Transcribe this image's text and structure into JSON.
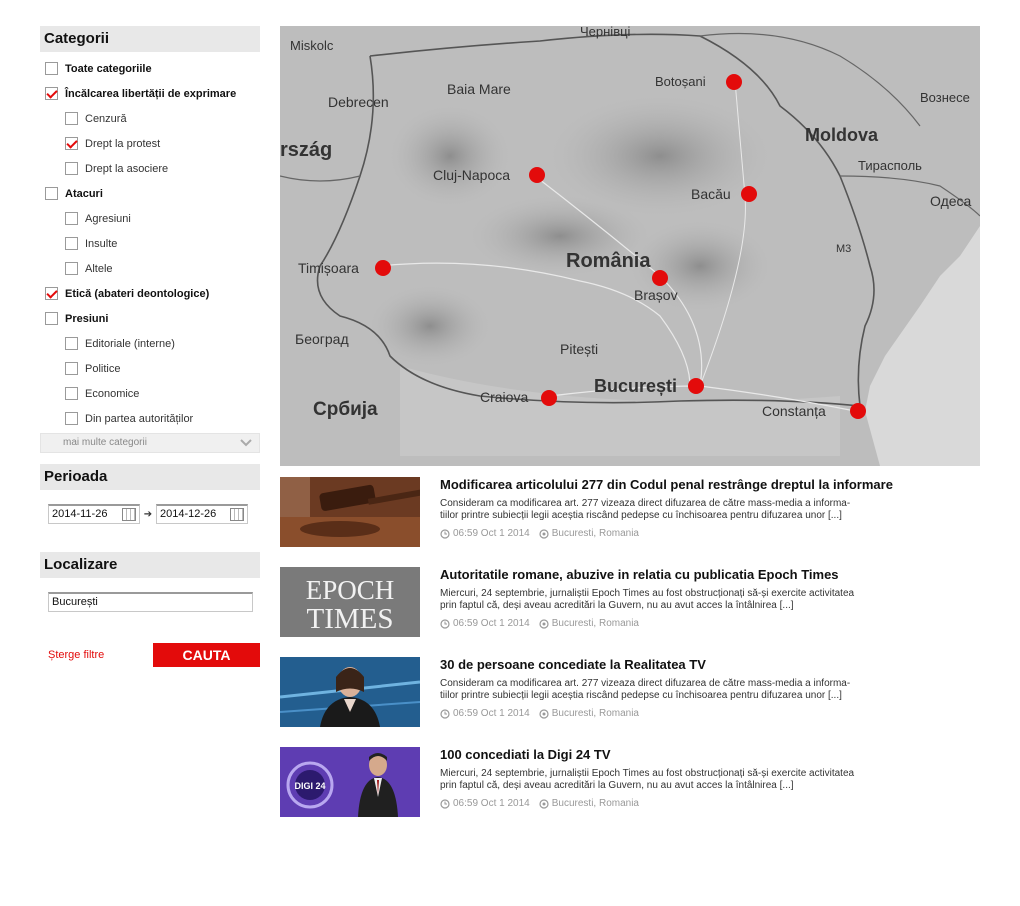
{
  "sidebar": {
    "categories_title": "Categorii",
    "categories": [
      {
        "label": "Toate categoriile",
        "level": 1,
        "checked": false
      },
      {
        "label": "Încălcarea libertății de exprimare",
        "level": 1,
        "checked": true
      },
      {
        "label": "Cenzură",
        "level": 2,
        "checked": false
      },
      {
        "label": "Drept la protest",
        "level": 2,
        "checked": true
      },
      {
        "label": "Drept la asociere",
        "level": 2,
        "checked": false
      },
      {
        "label": "Atacuri",
        "level": 1,
        "checked": false
      },
      {
        "label": "Agresiuni",
        "level": 2,
        "checked": false
      },
      {
        "label": "Insulte",
        "level": 2,
        "checked": false
      },
      {
        "label": "Altele",
        "level": 2,
        "checked": false
      },
      {
        "label": "Etică (abateri deontologice)",
        "level": 1,
        "checked": true
      },
      {
        "label": "Presiuni",
        "level": 1,
        "checked": false
      },
      {
        "label": "Editoriale (interne)",
        "level": 2,
        "checked": false
      },
      {
        "label": "Politice",
        "level": 2,
        "checked": false
      },
      {
        "label": "Economice",
        "level": 2,
        "checked": false
      },
      {
        "label": "Din partea autorităților",
        "level": 2,
        "checked": false
      }
    ],
    "more_categories": "mai multe categorii",
    "period_title": "Perioada",
    "date_from": "2014-11-26",
    "date_to": "2014-12-26",
    "location_title": "Localizare",
    "location_value": "București",
    "clear_filters": "Șterge filtre",
    "search_button": "CAUTA"
  },
  "map": {
    "labels": [
      {
        "text": "Chernivtsi",
        "display": "Чернівці"
      },
      {
        "text": "Miskolc",
        "display": "Miskolc"
      },
      {
        "text": "Baia Mare",
        "display": "Baia Mare"
      },
      {
        "text": "Botoșani",
        "display": "Botoșani"
      },
      {
        "text": "Voznesensk",
        "display": "Вознесе"
      },
      {
        "text": "Debrecen",
        "display": "Debrecen"
      },
      {
        "text": "Moldova",
        "display": "Moldova"
      },
      {
        "text": "Ország",
        "display": "rszág"
      },
      {
        "text": "Tiraspol",
        "display": "Тирасполь"
      },
      {
        "text": "Cluj-Napoca",
        "display": "Cluj-Napoca"
      },
      {
        "text": "Bacău",
        "display": "Bacău"
      },
      {
        "text": "Odesa",
        "display": "Одеса"
      },
      {
        "text": "M3",
        "display": "M3"
      },
      {
        "text": "România",
        "display": "România"
      },
      {
        "text": "Timișoara",
        "display": "Timișoara"
      },
      {
        "text": "Brașov",
        "display": "Brașov"
      },
      {
        "text": "Beograd",
        "display": "Београд"
      },
      {
        "text": "Pitești",
        "display": "Pitești"
      },
      {
        "text": "București",
        "display": "București"
      },
      {
        "text": "Srbija",
        "display": "Србија"
      },
      {
        "text": "Craiova",
        "display": "Craiova"
      },
      {
        "text": "Constanța",
        "display": "Constanța"
      }
    ],
    "markers": [
      "Botoșani",
      "Cluj-Napoca",
      "Bacău",
      "Timișoara",
      "Brașov",
      "București",
      "Craiova",
      "Constanța"
    ],
    "marker_color": "#e30b0b"
  },
  "articles": [
    {
      "title": "Modificarea articolului 277 din Codul penal restrânge dreptul la informare",
      "excerpt_line1": "Consideram ca modificarea art. 277 vizeaza direct difuzarea de către mass-media a informa-",
      "excerpt_line2": "tiilor printre subiecții legii aceștia riscând pedepse cu închisoarea pentru difuzarea unor [...]",
      "time": "06:59 Oct 1 2014",
      "location": "Bucuresti, Romania",
      "thumb": "gavel"
    },
    {
      "title": "Autoritatile romane, abuzive in relatia cu publicatia Epoch Times",
      "excerpt_line1": "Miercuri, 24 septembrie, jurnaliștii Epoch Times au fost obstrucționați să-și exercite activitatea",
      "excerpt_line2": "prin faptul că, deși aveau acreditări la Guvern, nu au avut acces la întâlnirea [...]",
      "time": "06:59 Oct 1 2014",
      "location": "Bucuresti, Romania",
      "thumb": "epoch",
      "thumb_text1": "EPOCH",
      "thumb_text2": "TIMES"
    },
    {
      "title": "30 de persoane concediate la Realitatea TV",
      "excerpt_line1": "Consideram ca modificarea art. 277 vizeaza direct difuzarea de către mass-media a informa-",
      "excerpt_line2": "tiilor printre subiecții legii aceștia riscând pedepse cu închisoarea pentru difuzarea unor [...]",
      "time": "06:59 Oct 1 2014",
      "location": "Bucuresti, Romania",
      "thumb": "realitatea"
    },
    {
      "title": "100 concediati la Digi 24 TV",
      "excerpt_line1": "Miercuri, 24 septembrie, jurnaliștii Epoch Times au fost obstrucționați să-și exercite activitatea",
      "excerpt_line2": "prin faptul că, deși aveau acreditări la Guvern, nu au avut acces la întâlnirea [...]",
      "time": "06:59 Oct 1 2014",
      "location": "Bucuresti, Romania",
      "thumb": "digi",
      "thumb_text": "DIGI 24"
    }
  ],
  "colors": {
    "accent": "#e30b0b",
    "section_bg": "#e8e8e8",
    "meta_text": "#999999"
  }
}
